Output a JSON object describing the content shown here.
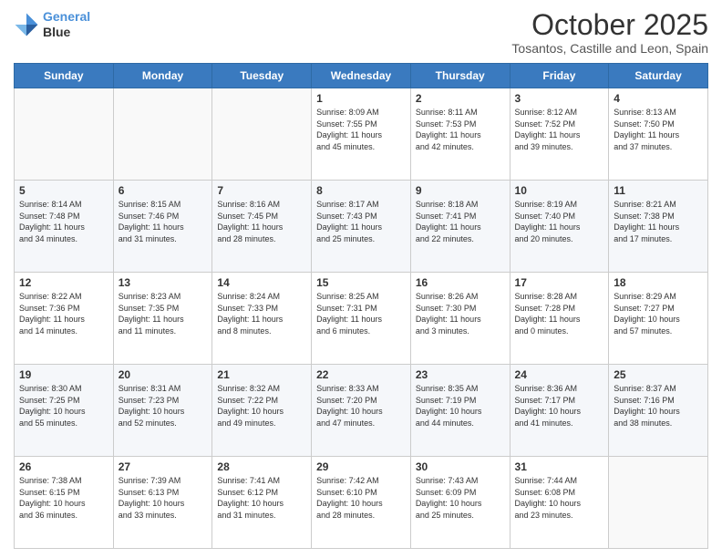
{
  "header": {
    "logo_line1": "General",
    "logo_line2": "Blue",
    "month": "October 2025",
    "location": "Tosantos, Castille and Leon, Spain"
  },
  "weekdays": [
    "Sunday",
    "Monday",
    "Tuesday",
    "Wednesday",
    "Thursday",
    "Friday",
    "Saturday"
  ],
  "weeks": [
    [
      {
        "day": "",
        "info": ""
      },
      {
        "day": "",
        "info": ""
      },
      {
        "day": "",
        "info": ""
      },
      {
        "day": "1",
        "info": "Sunrise: 8:09 AM\nSunset: 7:55 PM\nDaylight: 11 hours\nand 45 minutes."
      },
      {
        "day": "2",
        "info": "Sunrise: 8:11 AM\nSunset: 7:53 PM\nDaylight: 11 hours\nand 42 minutes."
      },
      {
        "day": "3",
        "info": "Sunrise: 8:12 AM\nSunset: 7:52 PM\nDaylight: 11 hours\nand 39 minutes."
      },
      {
        "day": "4",
        "info": "Sunrise: 8:13 AM\nSunset: 7:50 PM\nDaylight: 11 hours\nand 37 minutes."
      }
    ],
    [
      {
        "day": "5",
        "info": "Sunrise: 8:14 AM\nSunset: 7:48 PM\nDaylight: 11 hours\nand 34 minutes."
      },
      {
        "day": "6",
        "info": "Sunrise: 8:15 AM\nSunset: 7:46 PM\nDaylight: 11 hours\nand 31 minutes."
      },
      {
        "day": "7",
        "info": "Sunrise: 8:16 AM\nSunset: 7:45 PM\nDaylight: 11 hours\nand 28 minutes."
      },
      {
        "day": "8",
        "info": "Sunrise: 8:17 AM\nSunset: 7:43 PM\nDaylight: 11 hours\nand 25 minutes."
      },
      {
        "day": "9",
        "info": "Sunrise: 8:18 AM\nSunset: 7:41 PM\nDaylight: 11 hours\nand 22 minutes."
      },
      {
        "day": "10",
        "info": "Sunrise: 8:19 AM\nSunset: 7:40 PM\nDaylight: 11 hours\nand 20 minutes."
      },
      {
        "day": "11",
        "info": "Sunrise: 8:21 AM\nSunset: 7:38 PM\nDaylight: 11 hours\nand 17 minutes."
      }
    ],
    [
      {
        "day": "12",
        "info": "Sunrise: 8:22 AM\nSunset: 7:36 PM\nDaylight: 11 hours\nand 14 minutes."
      },
      {
        "day": "13",
        "info": "Sunrise: 8:23 AM\nSunset: 7:35 PM\nDaylight: 11 hours\nand 11 minutes."
      },
      {
        "day": "14",
        "info": "Sunrise: 8:24 AM\nSunset: 7:33 PM\nDaylight: 11 hours\nand 8 minutes."
      },
      {
        "day": "15",
        "info": "Sunrise: 8:25 AM\nSunset: 7:31 PM\nDaylight: 11 hours\nand 6 minutes."
      },
      {
        "day": "16",
        "info": "Sunrise: 8:26 AM\nSunset: 7:30 PM\nDaylight: 11 hours\nand 3 minutes."
      },
      {
        "day": "17",
        "info": "Sunrise: 8:28 AM\nSunset: 7:28 PM\nDaylight: 11 hours\nand 0 minutes."
      },
      {
        "day": "18",
        "info": "Sunrise: 8:29 AM\nSunset: 7:27 PM\nDaylight: 10 hours\nand 57 minutes."
      }
    ],
    [
      {
        "day": "19",
        "info": "Sunrise: 8:30 AM\nSunset: 7:25 PM\nDaylight: 10 hours\nand 55 minutes."
      },
      {
        "day": "20",
        "info": "Sunrise: 8:31 AM\nSunset: 7:23 PM\nDaylight: 10 hours\nand 52 minutes."
      },
      {
        "day": "21",
        "info": "Sunrise: 8:32 AM\nSunset: 7:22 PM\nDaylight: 10 hours\nand 49 minutes."
      },
      {
        "day": "22",
        "info": "Sunrise: 8:33 AM\nSunset: 7:20 PM\nDaylight: 10 hours\nand 47 minutes."
      },
      {
        "day": "23",
        "info": "Sunrise: 8:35 AM\nSunset: 7:19 PM\nDaylight: 10 hours\nand 44 minutes."
      },
      {
        "day": "24",
        "info": "Sunrise: 8:36 AM\nSunset: 7:17 PM\nDaylight: 10 hours\nand 41 minutes."
      },
      {
        "day": "25",
        "info": "Sunrise: 8:37 AM\nSunset: 7:16 PM\nDaylight: 10 hours\nand 38 minutes."
      }
    ],
    [
      {
        "day": "26",
        "info": "Sunrise: 7:38 AM\nSunset: 6:15 PM\nDaylight: 10 hours\nand 36 minutes."
      },
      {
        "day": "27",
        "info": "Sunrise: 7:39 AM\nSunset: 6:13 PM\nDaylight: 10 hours\nand 33 minutes."
      },
      {
        "day": "28",
        "info": "Sunrise: 7:41 AM\nSunset: 6:12 PM\nDaylight: 10 hours\nand 31 minutes."
      },
      {
        "day": "29",
        "info": "Sunrise: 7:42 AM\nSunset: 6:10 PM\nDaylight: 10 hours\nand 28 minutes."
      },
      {
        "day": "30",
        "info": "Sunrise: 7:43 AM\nSunset: 6:09 PM\nDaylight: 10 hours\nand 25 minutes."
      },
      {
        "day": "31",
        "info": "Sunrise: 7:44 AM\nSunset: 6:08 PM\nDaylight: 10 hours\nand 23 minutes."
      },
      {
        "day": "",
        "info": ""
      }
    ]
  ]
}
